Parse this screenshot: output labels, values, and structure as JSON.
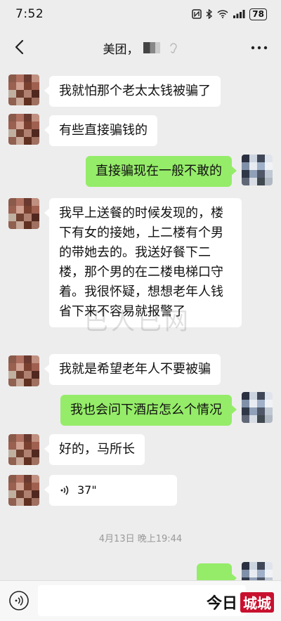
{
  "status_bar": {
    "time": "7:52",
    "battery": "78"
  },
  "nav": {
    "title": "美团，"
  },
  "messages": [
    {
      "side": "left",
      "text": "我就怕那个老太太钱被骗了"
    },
    {
      "side": "left",
      "text": "有些直接骗钱的"
    },
    {
      "side": "right",
      "text": "直接骗现在一般不敢的"
    },
    {
      "side": "left",
      "text": "我早上送餐的时候发现的，楼下有女的接她，上二楼有个男的带她去的。我送好餐下二楼，那个男的在二楼电梯口守着。我很怀疑，想想老年人钱省下来不容易就报警了"
    },
    {
      "side": "left",
      "text": "我就是希望老年人不要被骗"
    },
    {
      "side": "right",
      "text": "我也会问下酒店怎么个情况"
    },
    {
      "side": "left",
      "text": "好的，马所长"
    },
    {
      "side": "left",
      "type": "voice",
      "duration": "37\""
    }
  ],
  "timestamp": "4月13日 晚上19:44",
  "watermark": "巴人已网",
  "logo": {
    "text": "今日",
    "seal": "城城"
  },
  "colors": {
    "background": "#ededed",
    "bubble_right": "#95ec69",
    "bubble_left": "#ffffff"
  }
}
